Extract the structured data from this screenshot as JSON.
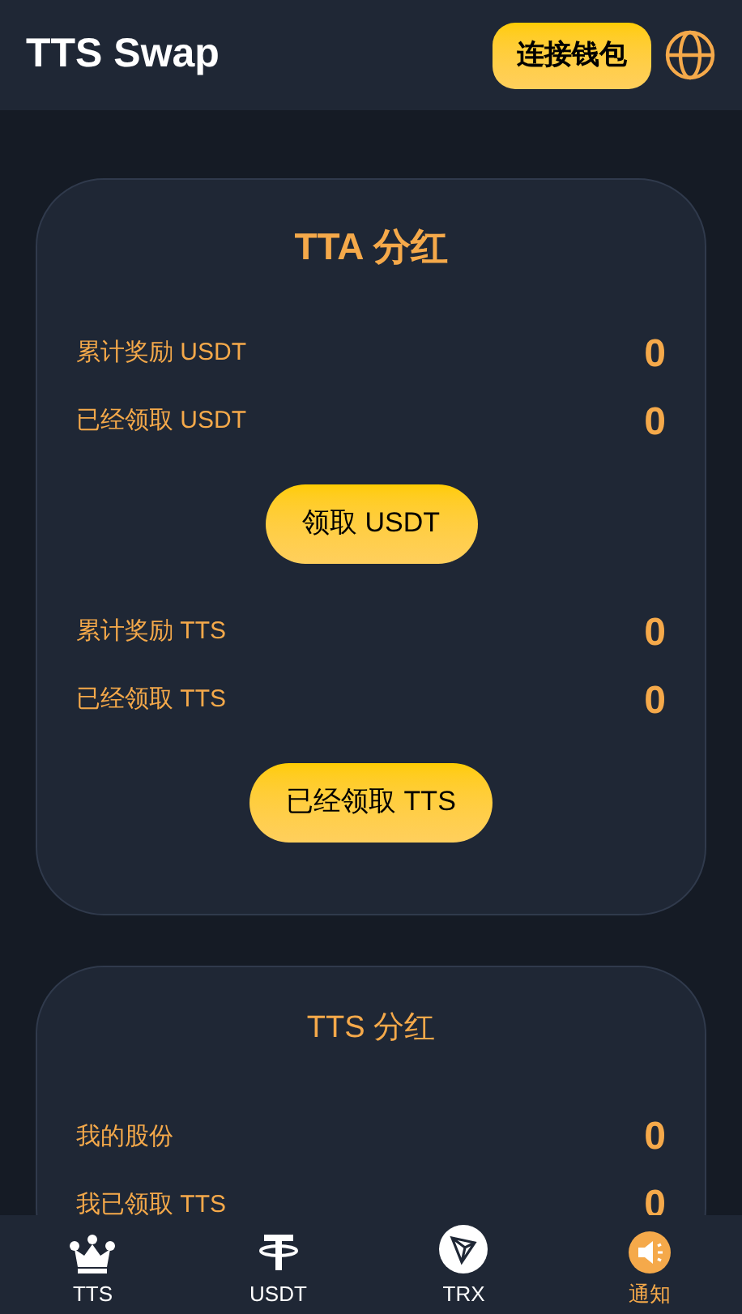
{
  "header": {
    "title": "TTS Swap",
    "connect_button": "连接钱包"
  },
  "cards": [
    {
      "title": "TTA 分红",
      "title_bold": true,
      "sections": [
        {
          "rows": [
            {
              "label": "累计奖励 USDT",
              "value": "0"
            },
            {
              "label": "已经领取 USDT",
              "value": "0"
            }
          ],
          "button": "领取 USDT"
        },
        {
          "rows": [
            {
              "label": "累计奖励 TTS",
              "value": "0"
            },
            {
              "label": "已经领取 TTS",
              "value": "0"
            }
          ],
          "button": "已经领取 TTS"
        }
      ]
    },
    {
      "title": "TTS 分红",
      "title_bold": false,
      "sections": [
        {
          "rows": [
            {
              "label": "我的股份",
              "value": "0"
            },
            {
              "label": "我已领取 TTS",
              "value": "0"
            }
          ]
        }
      ]
    }
  ],
  "bottom_nav": [
    {
      "label": "TTS",
      "kind": "crown",
      "selected": false
    },
    {
      "label": "USDT",
      "kind": "tether",
      "selected": false
    },
    {
      "label": "TRX",
      "kind": "tron",
      "selected": false
    },
    {
      "label": "通知",
      "kind": "megaphone",
      "selected": true
    }
  ]
}
